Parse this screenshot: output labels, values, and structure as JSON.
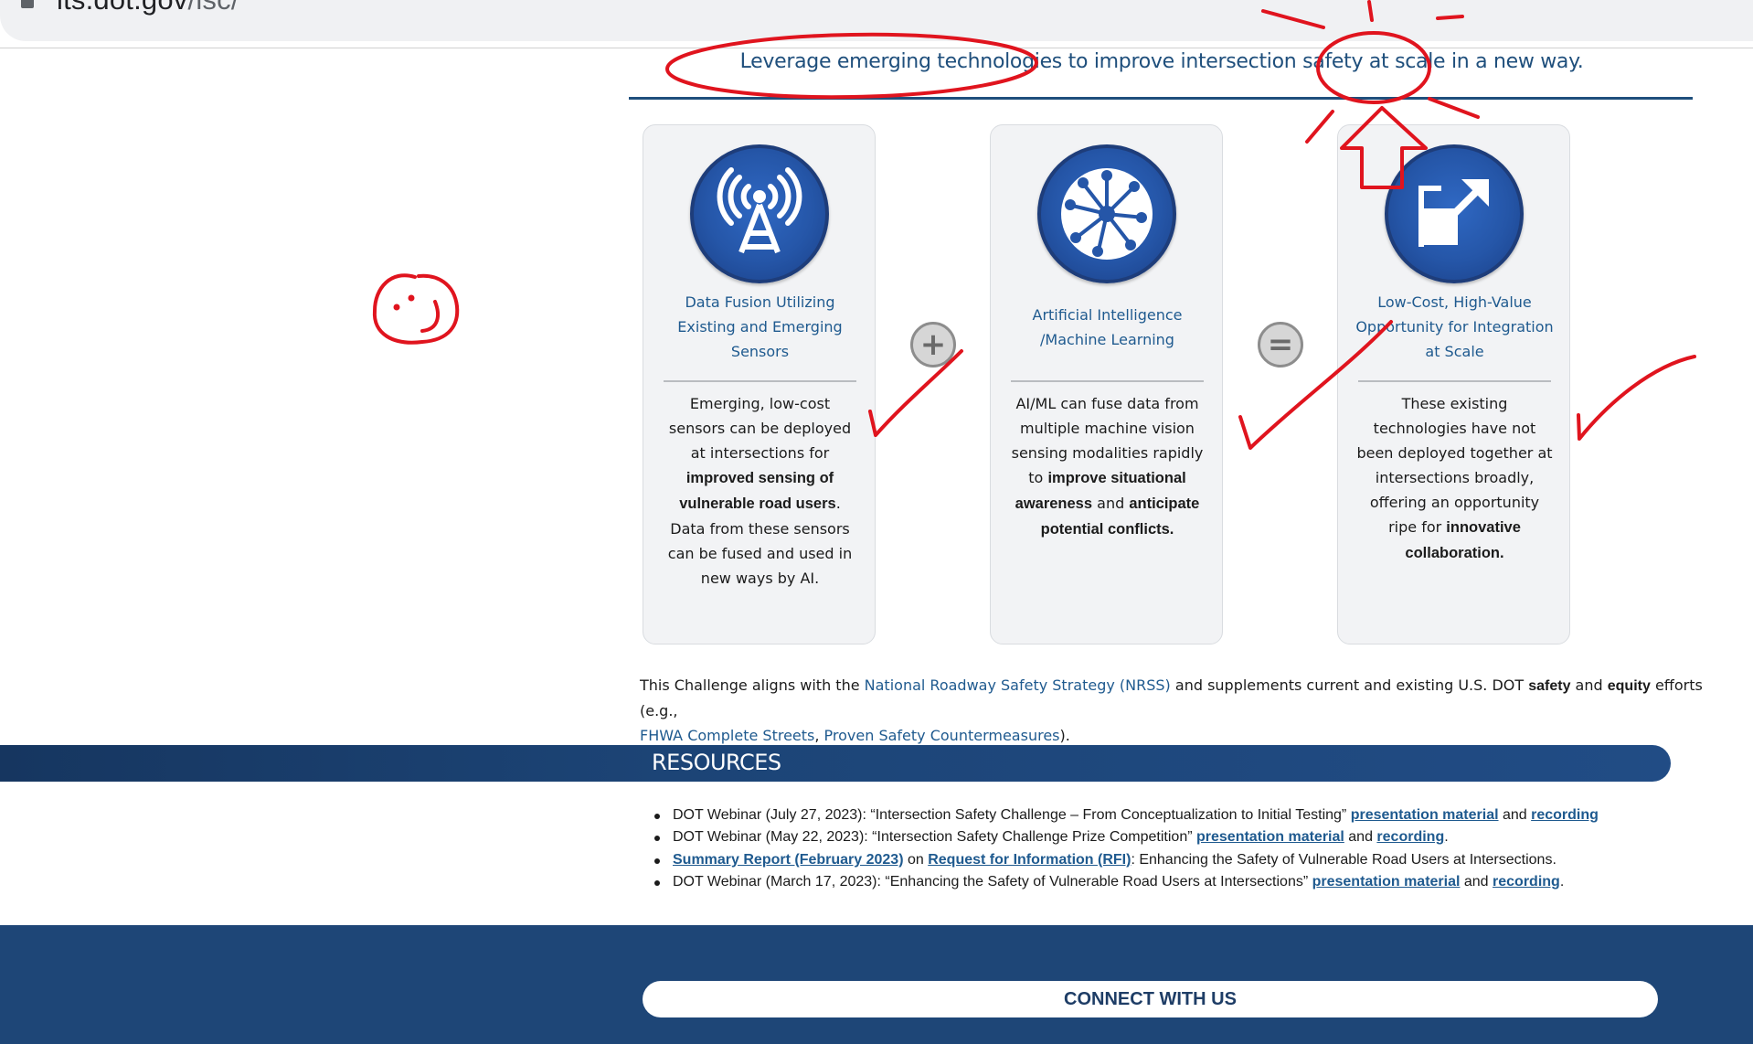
{
  "browser": {
    "url_host": "its.dot.gov",
    "url_path": "/isc/"
  },
  "headline": "Leverage emerging technologies to improve intersection safety at scale in a new way.",
  "cards": [
    {
      "icon": "radio-tower-icon",
      "title": "Data Fusion Utilizing Existing and Emerging Sensors",
      "body_segments": [
        {
          "text": "Emerging, low-cost sensors can be deployed at intersections for ",
          "bold": false
        },
        {
          "text": "improved sensing of vulnerable road users",
          "bold": true
        },
        {
          "text": ". Data from these sensors can be fused and used in new ways by AI.",
          "bold": false
        }
      ]
    },
    {
      "icon": "neural-network-icon",
      "title": "Artificial Intelligence /Machine Learning",
      "body_segments": [
        {
          "text": "AI/ML can fuse data from multiple machine vision sensing modalities rapidly to ",
          "bold": false
        },
        {
          "text": "improve situational awareness",
          "bold": true
        },
        {
          "text": " and ",
          "bold": false
        },
        {
          "text": "anticipate potential conflicts.",
          "bold": true
        }
      ]
    },
    {
      "icon": "scale-up-arrow-icon",
      "title": "Low-Cost, High-Value Opportunity for Integration at Scale",
      "body_segments": [
        {
          "text": "These existing technologies have not been deployed together at intersections broadly, offering an opportunity ripe for ",
          "bold": false
        },
        {
          "text": "innovative collaboration.",
          "bold": true
        }
      ]
    }
  ],
  "operators": {
    "plus": "+",
    "equals": "="
  },
  "alignment": {
    "t1": "This Challenge aligns with the ",
    "link_nrss": "National Roadway Safety Strategy (NRSS)",
    "t2": " and supplements current and existing U.S. DOT ",
    "b_safety": "safety",
    "t3": " and ",
    "b_equity": "equity",
    "t4": " efforts (e.g.,",
    "link_fhwa": "FHWA Complete Streets",
    "t5": ", ",
    "link_proven": "Proven Safety Countermeasures",
    "t6": ")."
  },
  "resources": {
    "title": "RESOURCES",
    "items": [
      {
        "segments": [
          {
            "text": "DOT Webinar (July 27, 2023): “Intersection Safety Challenge – From Conceptualization to Initial Testing” ",
            "link": false
          },
          {
            "text": "presentation material",
            "link": true
          },
          {
            "text": " and ",
            "link": false
          },
          {
            "text": "recording",
            "link": true
          }
        ]
      },
      {
        "segments": [
          {
            "text": "DOT Webinar (May 22, 2023): “Intersection Safety Challenge Prize Competition” ",
            "link": false
          },
          {
            "text": "presentation material",
            "link": true
          },
          {
            "text": " and ",
            "link": false
          },
          {
            "text": "recording",
            "link": true
          },
          {
            "text": ".",
            "link": false
          }
        ]
      },
      {
        "segments": [
          {
            "text": "Summary Report (February 2023)",
            "link": true
          },
          {
            "text": " on ",
            "link": false
          },
          {
            "text": "Request for Information (RFI)",
            "link": true
          },
          {
            "text": ": Enhancing the Safety of Vulnerable Road Users at Intersections.",
            "link": false
          }
        ]
      },
      {
        "segments": [
          {
            "text": "DOT Webinar (March 17, 2023): “Enhancing the Safety of Vulnerable Road Users at Intersections” ",
            "link": false
          },
          {
            "text": "presentation material",
            "link": true
          },
          {
            "text": " and ",
            "link": false
          },
          {
            "text": "recording",
            "link": true
          },
          {
            "text": ".",
            "link": false
          }
        ]
      }
    ]
  },
  "footer": {
    "connect_label": "CONNECT WITH US"
  },
  "colors": {
    "brand_navy": "#1e4677",
    "link_blue": "#1f5a8f",
    "annotation_red": "#e0141e"
  }
}
